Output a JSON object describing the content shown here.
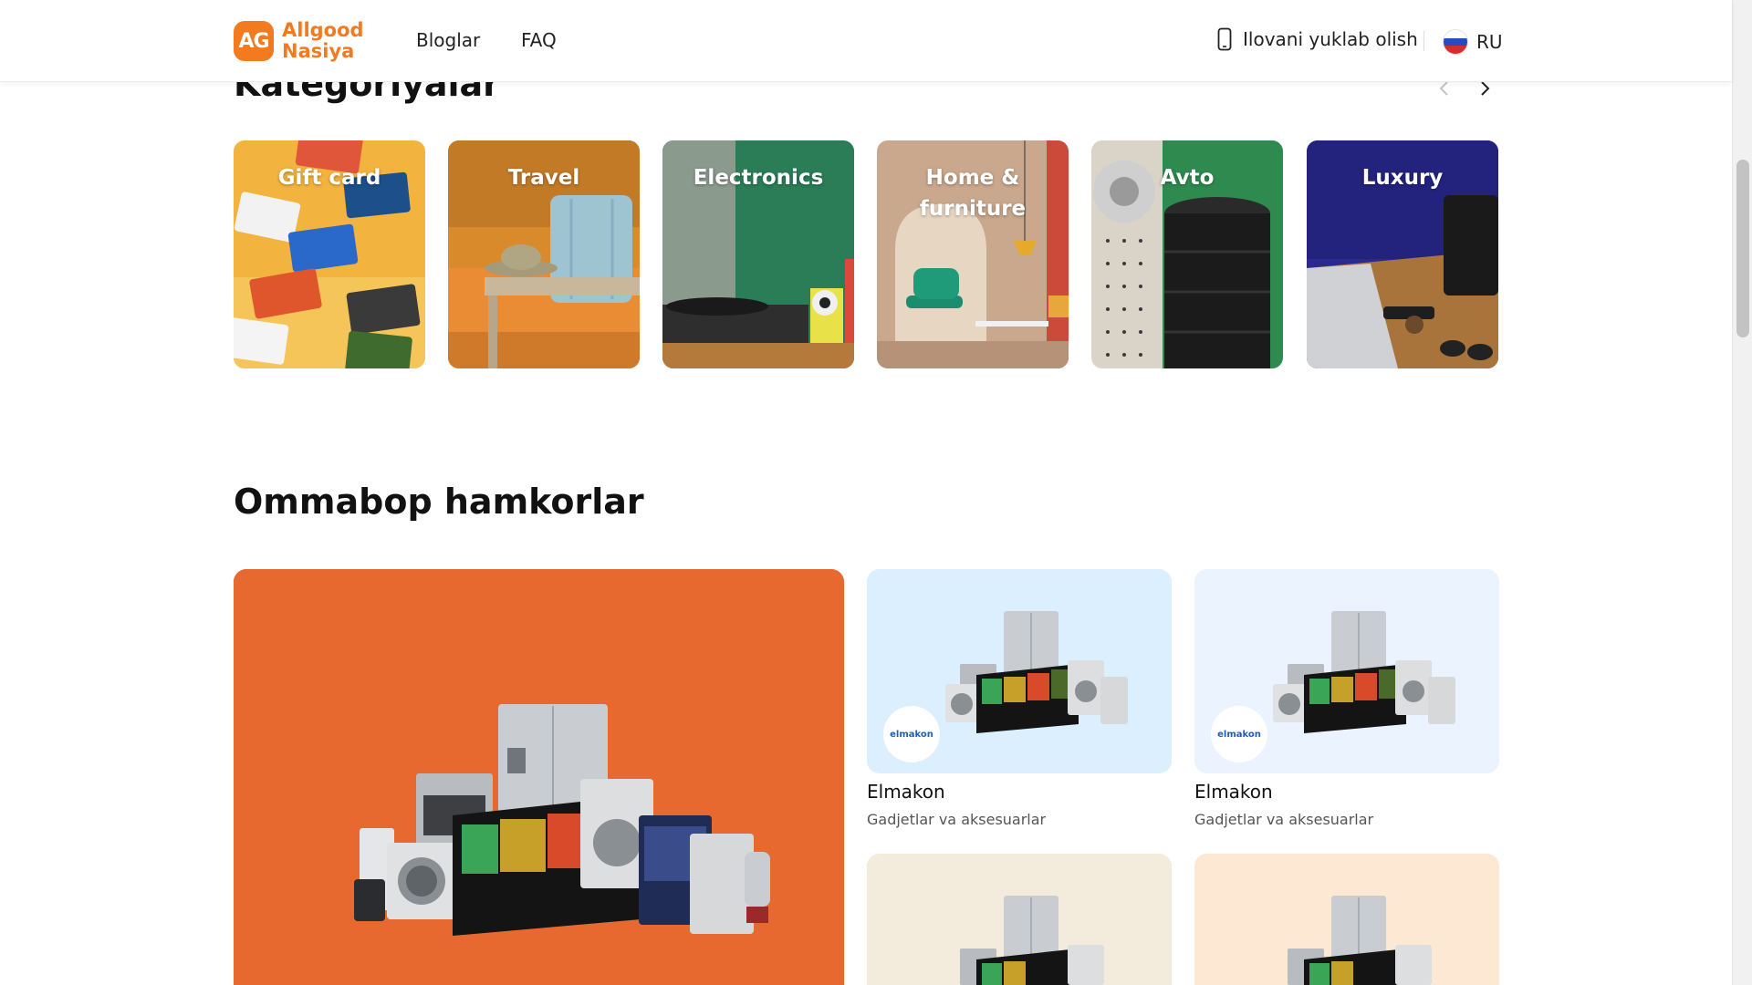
{
  "header": {
    "logo_badge": "AG",
    "logo_line1": "Allgood",
    "logo_line2": "Nasiya",
    "nav": [
      "Bloglar",
      "FAQ"
    ],
    "download_label": "Ilovani yuklab olish",
    "language": "RU"
  },
  "categories": {
    "title": "Kategoriyalar",
    "items": [
      {
        "label": "Gift card",
        "bg": "#f3b33f"
      },
      {
        "label": "Travel",
        "bg": "#d98a2b"
      },
      {
        "label": "Electronics",
        "bg": "#2a7d57"
      },
      {
        "label": "Home & furniture",
        "bg": "#c9a88d"
      },
      {
        "label": "Avto",
        "bg": "#2f8a4f"
      },
      {
        "label": "Luxury",
        "bg": "#29298e"
      }
    ]
  },
  "partners": {
    "title": "Ommabop hamkorlar",
    "hero_bg": "#e8692f",
    "cards": [
      {
        "name": "Elmakon",
        "subtitle": "Gadjetlar va aksesuarlar",
        "logo": "elmakon",
        "bg": "#dcefff"
      },
      {
        "name": "Elmakon",
        "subtitle": "Gadjetlar va aksesuarlar",
        "logo": "elmakon",
        "bg": "#eaf3ff"
      },
      {
        "name": "",
        "subtitle": "",
        "logo": "",
        "bg": "#f3ecdc"
      },
      {
        "name": "",
        "subtitle": "",
        "logo": "",
        "bg": "#fde8d4"
      }
    ]
  }
}
